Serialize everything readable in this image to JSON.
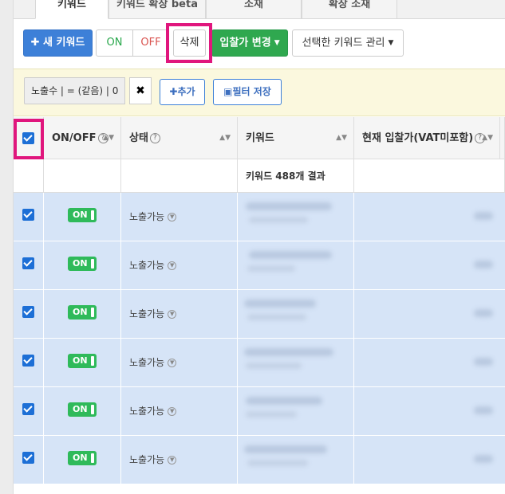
{
  "tabs": [
    {
      "label": "키워드",
      "active": true
    },
    {
      "label": "키워드 확장 beta",
      "active": false
    },
    {
      "label": "소재",
      "active": false
    },
    {
      "label": "확장 소재",
      "active": false
    }
  ],
  "toolbar": {
    "new_keyword": "새 키워드",
    "on": "ON",
    "off": "OFF",
    "delete": "삭제",
    "bid_change": "입찰가 변경",
    "manage_selected": "선택한 키워드 관리"
  },
  "filter": {
    "chip": "노출수 | = (같음) | 0",
    "remove": "✖",
    "add": "추가",
    "save": "필터 저장"
  },
  "table": {
    "headers": {
      "onoff": "ON/OFF",
      "status": "상태",
      "keyword": "키워드",
      "bid": "현재 입찰가(VAT미포함)"
    },
    "summary": "키워드 488개 결과",
    "rows": [
      {
        "toggle": "ON",
        "status": "노출가능"
      },
      {
        "toggle": "ON",
        "status": "노출가능"
      },
      {
        "toggle": "ON",
        "status": "노출가능"
      },
      {
        "toggle": "ON",
        "status": "노출가능"
      },
      {
        "toggle": "ON",
        "status": "노출가능"
      },
      {
        "toggle": "ON",
        "status": "노출가능"
      }
    ]
  },
  "colors": {
    "primary": "#3d80d8",
    "green": "#2fa84f",
    "highlight": "#e0167d",
    "row_selected": "#d6e4f7"
  }
}
